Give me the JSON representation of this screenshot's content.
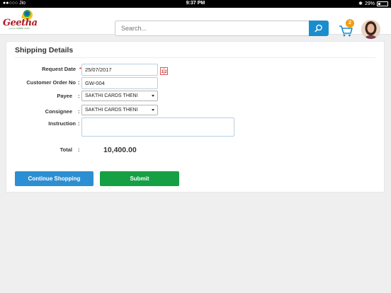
{
  "status_bar": {
    "carrier": "●●○○○ Jio",
    "time": "9:37 PM",
    "battery_percent": "29%",
    "battery_level": 0.29
  },
  "header": {
    "logo_text": "Geetha",
    "logo_tagline": "மங்கள CARDS தேனி",
    "search_placeholder": "Search...",
    "cart_count": "2",
    "icons": {
      "search": "search-icon",
      "cart": "cart-icon",
      "avatar": "user-avatar"
    }
  },
  "form": {
    "title": "Shipping Details",
    "request_date": {
      "label": "Request Date",
      "required_mark": "*",
      "value": "25/07/2017"
    },
    "customer_order_no": {
      "label": "Customer Order No",
      "value": "GW-004"
    },
    "payee": {
      "label": "Payee",
      "value": "SAKTHI CARDS THENI"
    },
    "consignee": {
      "label": "Consignee",
      "value": "SAKTHI CARDS THENI"
    },
    "instruction": {
      "label": "Instruction",
      "value": ""
    },
    "total": {
      "label": "Total",
      "value": "10,400.00"
    },
    "colon": ":",
    "calendar_icon_text": "12"
  },
  "actions": {
    "continue_label": "Continue Shopping",
    "submit_label": "Submit"
  },
  "colors": {
    "primary_blue": "#2d8fd3",
    "submit_green": "#15a044",
    "search_button": "#1b8ccc",
    "cart_badge": "#f39c12",
    "required": "#d9342b"
  }
}
